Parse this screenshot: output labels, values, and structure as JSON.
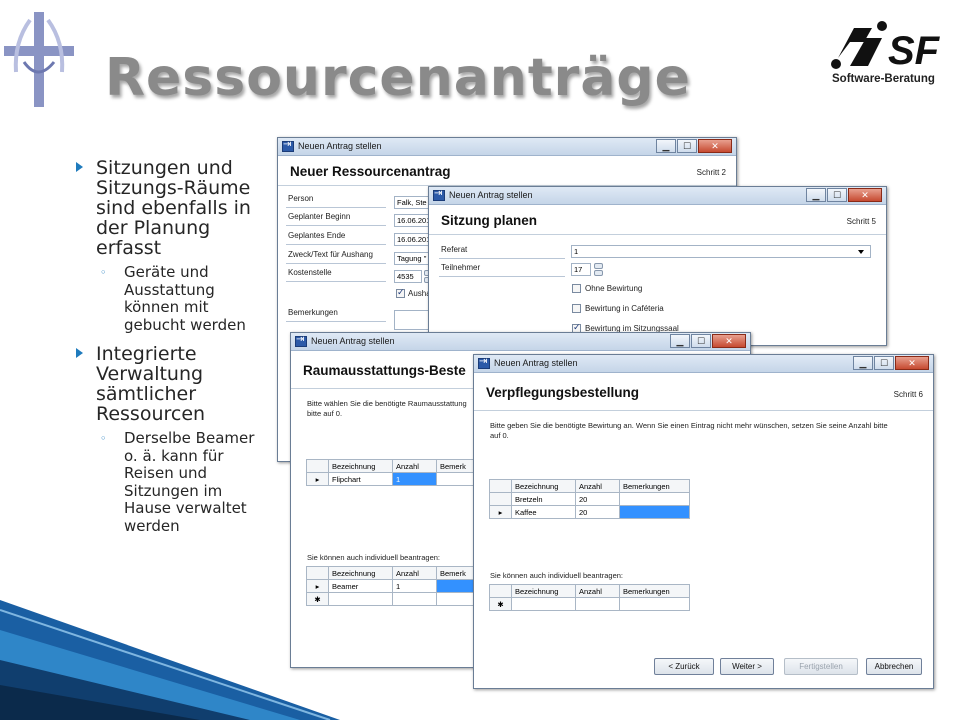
{
  "slide": {
    "title": "Ressourcenanträge",
    "logo_text": "Software-Beratung"
  },
  "bullets": [
    {
      "text": "Sitzungen und Sitzungs-Räume sind ebenfalls in der Planung erfasst"
    },
    {
      "text": "Geräte und Ausstattung können mit gebucht werden"
    },
    {
      "text": "Integrierte Verwaltung sämtlicher Ressourcen"
    },
    {
      "text": "Derselbe Beamer o. ä. kann für Reisen und Sitzungen im Hause verwaltet werden"
    }
  ],
  "win1": {
    "title": "Neuen Antrag stellen",
    "heading": "Neuer Ressourcenantrag",
    "step": "Schritt 2",
    "labels": [
      "Person",
      "Geplanter Beginn",
      "Geplantes Ende",
      "Zweck/Text für Aushang",
      "Kostenstelle",
      "Bemerkungen"
    ],
    "values": [
      "Falk, Ste",
      "16.06.201",
      "16.06.201",
      "Tagung \"",
      "4535"
    ],
    "checkbox_label": "Ausha"
  },
  "win2": {
    "title": "Neuen Antrag stellen",
    "heading": "Sitzung planen",
    "step": "Schritt 5",
    "referat_label": "Referat",
    "referat_value": "1",
    "teilnehmer_label": "Teilnehmer",
    "teilnehmer_value": "17",
    "options": [
      {
        "label": "Ohne Bewirtung",
        "checked": false
      },
      {
        "label": "Bewirtung in Caféteria",
        "checked": false
      },
      {
        "label": "Bewirtung im Sitzungssaal",
        "checked": true
      }
    ]
  },
  "win3": {
    "title": "Neuen Antrag stellen",
    "heading": "Raumausstattungs-Beste",
    "intro": "Bitte wählen Sie die benötigte Raumausstattung",
    "intro2": "bitte auf 0.",
    "columns": [
      "Bezeichnung",
      "Anzahl",
      "Bemerk"
    ],
    "rows": [
      {
        "name": "Flipchart",
        "count": "1"
      }
    ],
    "individual_label": "Sie können auch individuell beantragen:",
    "individual_columns": [
      "Bezeichnung",
      "Anzahl",
      "Bemerk"
    ],
    "individual_rows": [
      {
        "name": "Beamer",
        "count": "1"
      }
    ]
  },
  "win4": {
    "title": "Neuen Antrag stellen",
    "heading": "Verpflegungsbestellung",
    "step": "Schritt 6",
    "intro": "Bitte geben Sie die benötigte Bewirtung an. Wenn Sie einen Eintrag nicht mehr wünschen, setzen Sie seine Anzahl bitte",
    "intro2": "auf 0.",
    "columns": [
      "Bezeichnung",
      "Anzahl",
      "Bemerkungen"
    ],
    "rows": [
      {
        "name": "Bretzeln",
        "count": "20"
      },
      {
        "name": "Kaffee",
        "count": "20"
      }
    ],
    "individual_label": "Sie können auch individuell beantragen:",
    "individual_columns": [
      "Bezeichnung",
      "Anzahl",
      "Bemerkungen"
    ],
    "buttons": {
      "back": "< Zurück",
      "next": "Weiter >",
      "finish": "Fertigstellen",
      "cancel": "Abbrechen"
    }
  },
  "colors": {
    "accent": "#1f7bbd",
    "selection": "#3391ff",
    "title_gray": "#8a8a8a"
  }
}
